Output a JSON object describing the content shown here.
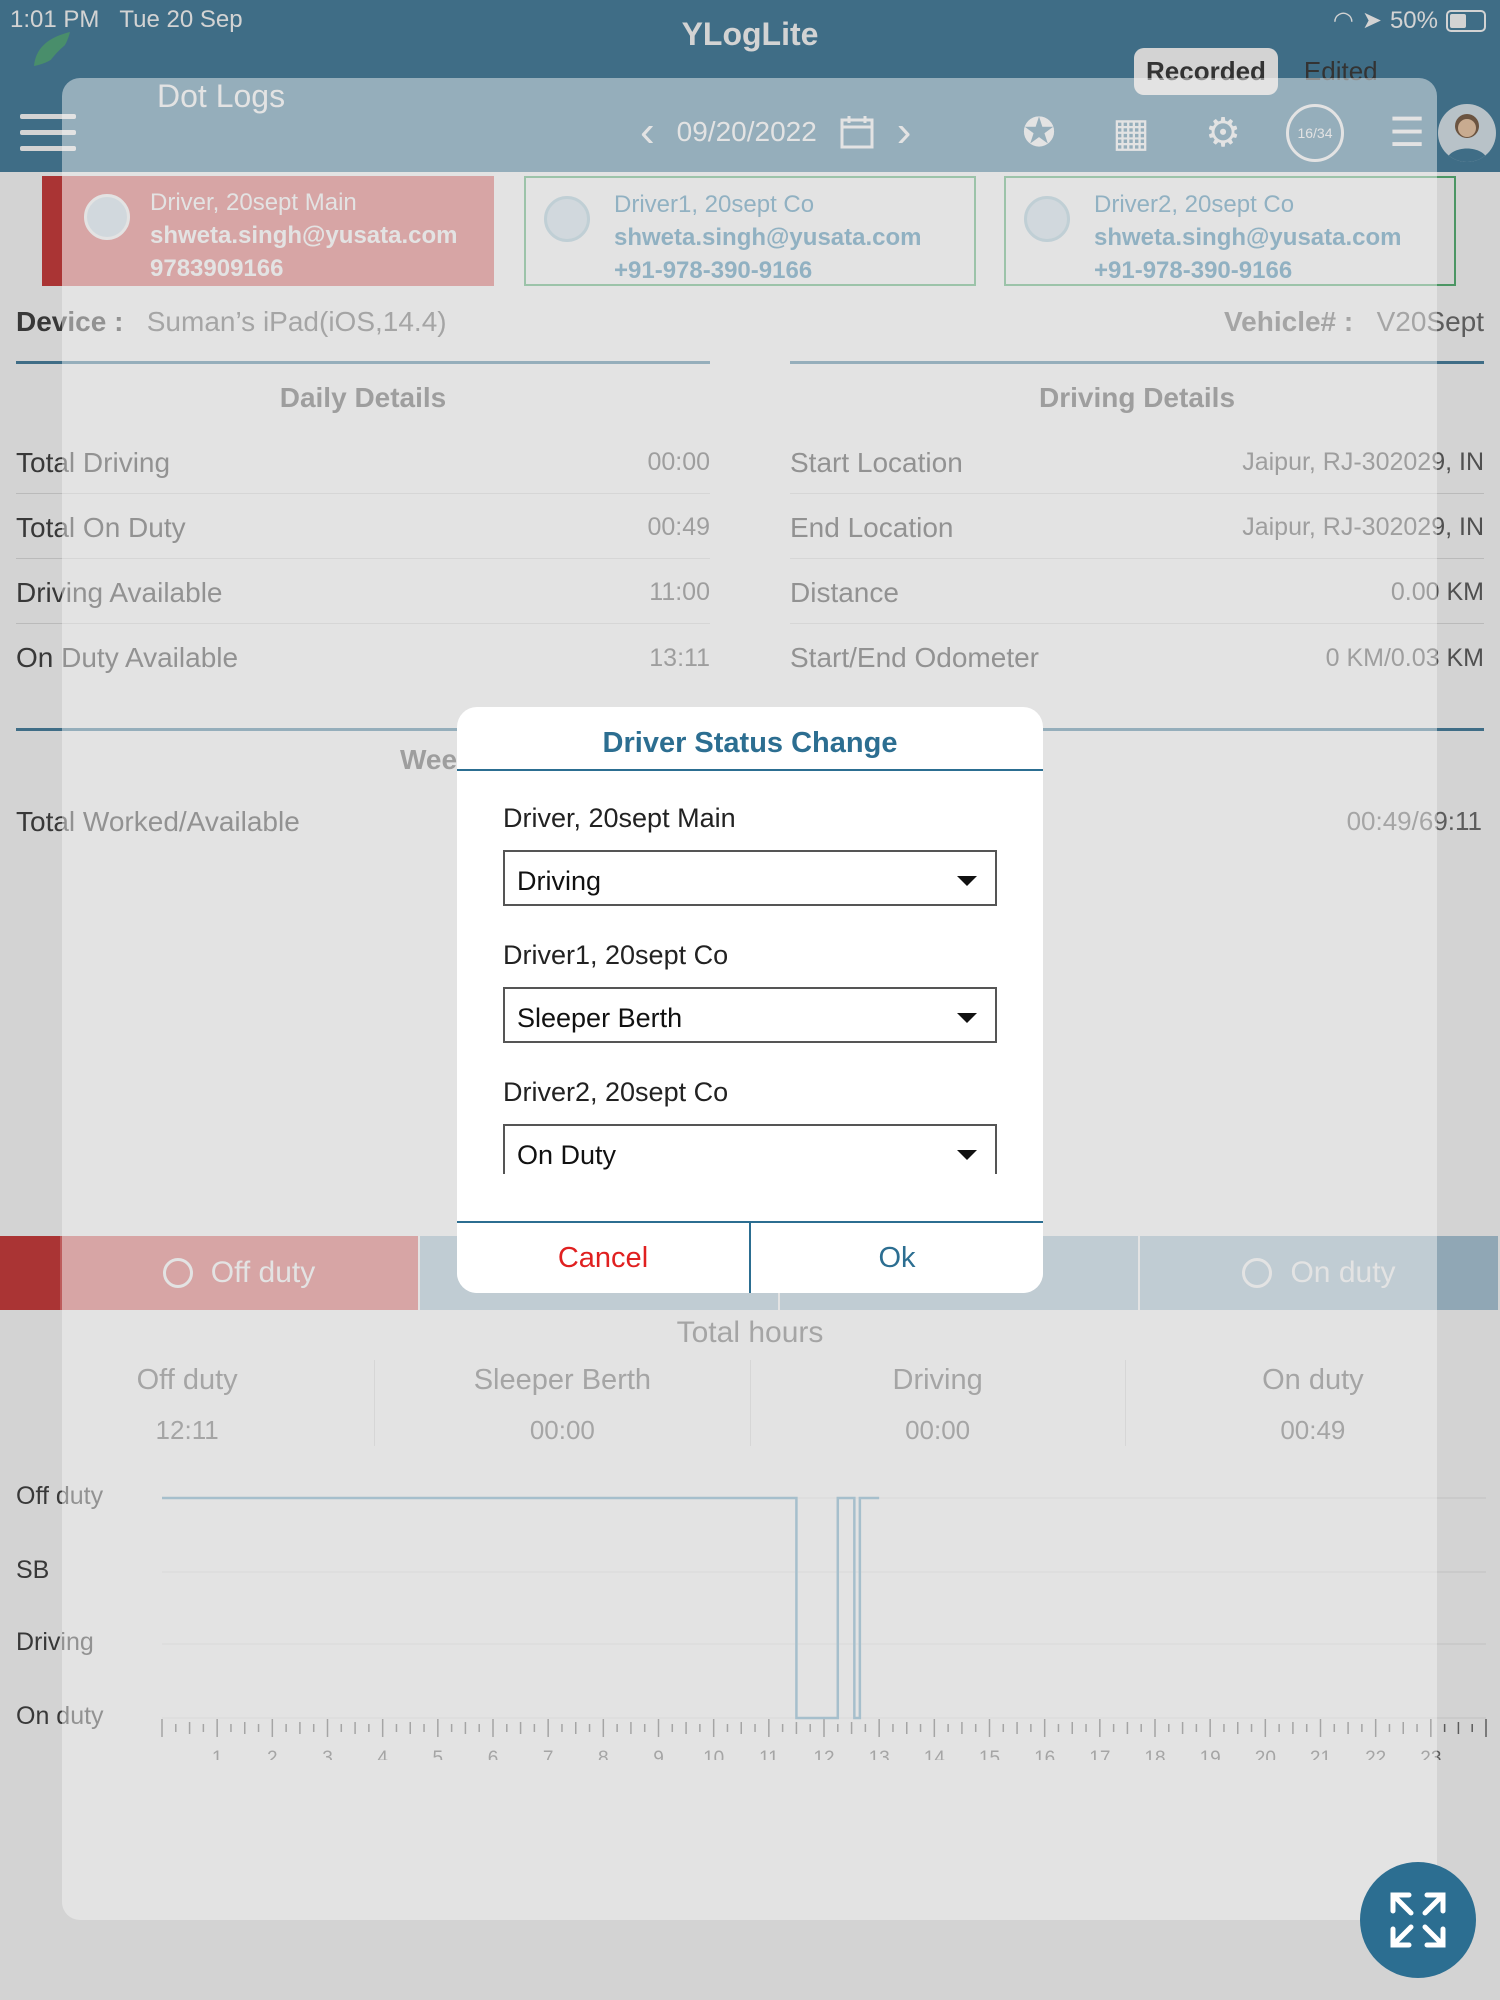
{
  "status_bar": {
    "time": "1:01 PM",
    "date": "Tue 20 Sep",
    "battery": "50%"
  },
  "app": {
    "title": "YLogLite"
  },
  "mode_tabs": {
    "recorded": "Recorded",
    "edited": "Edited"
  },
  "nav": {
    "title": "Dot Logs",
    "date": "09/20/2022",
    "cycle_badge": "16/34"
  },
  "drivers": [
    {
      "name": "Driver, 20sept Main",
      "email": "shweta.singh@yusata.com",
      "phone": "9783909166"
    },
    {
      "name": "Driver1, 20sept Co",
      "email": "shweta.singh@yusata.com",
      "phone": "+91-978-390-9166"
    },
    {
      "name": "Driver2, 20sept Co",
      "email": "shweta.singh@yusata.com",
      "phone": "+91-978-390-9166"
    }
  ],
  "device": {
    "label": "Device :",
    "value": "Suman’s iPad(iOS,14.4)",
    "vehicle_label": "Vehicle# :",
    "vehicle_value": "V20Sept"
  },
  "daily": {
    "title": "Daily Details",
    "rows": [
      {
        "label": "Total Driving",
        "value": "00:00"
      },
      {
        "label": "Total On Duty",
        "value": "00:49"
      },
      {
        "label": "Driving Available",
        "value": "11:00"
      },
      {
        "label": "On Duty Available",
        "value": "13:11"
      }
    ]
  },
  "driving": {
    "title": "Driving Details",
    "rows": [
      {
        "label": "Start Location",
        "value": "Jaipur, RJ-302029, IN"
      },
      {
        "label": "End Location",
        "value": "Jaipur, RJ-302029, IN"
      },
      {
        "label": "Distance",
        "value": "0.00 KM"
      },
      {
        "label": "Start/End Odometer",
        "value": "0 KM/0.03 KM"
      }
    ]
  },
  "weekly": {
    "title": "Wee",
    "label": "Total Worked/Available",
    "value": "00:49/69:11"
  },
  "status_tabs": {
    "off_duty": "Off duty",
    "sleeper": "",
    "driving": "",
    "on_duty": "On duty"
  },
  "total_hours": {
    "title": "Total hours",
    "cells": [
      {
        "label": "Off duty",
        "value": "12:11"
      },
      {
        "label": "Sleeper Berth",
        "value": "00:00"
      },
      {
        "label": "Driving",
        "value": "00:00"
      },
      {
        "label": "On duty",
        "value": "00:49"
      }
    ]
  },
  "graph": {
    "rows": [
      "Off duty",
      "SB",
      "Driving",
      "On duty"
    ],
    "hours": [
      "1",
      "2",
      "3",
      "4",
      "5",
      "6",
      "7",
      "8",
      "9",
      "10",
      "11",
      "12",
      "13",
      "14",
      "15",
      "16",
      "17",
      "18",
      "19",
      "20",
      "21",
      "22",
      "23"
    ]
  },
  "dialog": {
    "title": "Driver Status Change",
    "entries": [
      {
        "driver": "Driver, 20sept Main",
        "status": "Driving"
      },
      {
        "driver": "Driver1, 20sept Co",
        "status": "Sleeper Berth"
      },
      {
        "driver": "Driver2, 20sept Co",
        "status": "On Duty"
      }
    ],
    "cancel": "Cancel",
    "ok": "Ok"
  },
  "colors": {
    "primary": "#2c6e91",
    "danger": "#e05555",
    "danger_dark": "#c51c1c",
    "accent_green": "#3ea860"
  }
}
